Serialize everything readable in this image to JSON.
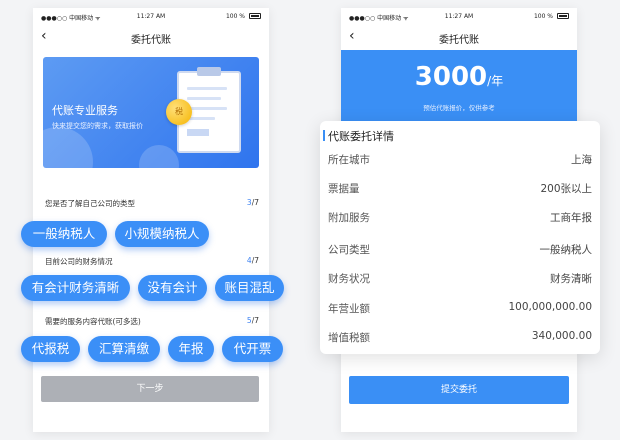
{
  "status": {
    "carrier": "●●●○○ 中国移动 ᯤ",
    "time": "11:27 AM",
    "battery": "100 %"
  },
  "left": {
    "nav": {
      "title": "委托代账"
    },
    "banner": {
      "title": "代账专业服务",
      "subtitle": "快来提交您的需求，获取报价",
      "coin": "税"
    },
    "q1": {
      "text": "您是否了解自己公司的类型",
      "current": "3",
      "total": "/7"
    },
    "q2": {
      "text": "目前公司的财务情况",
      "current": "4",
      "total": "/7"
    },
    "q3": {
      "text": "需要的服务内容代账(可多选)",
      "current": "5",
      "total": "/7"
    },
    "options1": [
      "一般纳税人",
      "小规模纳税人"
    ],
    "options2": [
      "有会计财务清晰",
      "没有会计",
      "账目混乱"
    ],
    "options3": [
      "代报税",
      "汇算清缴",
      "年报",
      "代开票"
    ],
    "next_button": "下一步"
  },
  "right": {
    "nav": {
      "title": "委托代账"
    },
    "price": {
      "amount": "3000",
      "unit": "/年",
      "subtitle": "预估代账报价，仅供参考"
    },
    "card": {
      "title": "代账委托详情",
      "rows": [
        {
          "label": "所在城市",
          "value": "上海"
        },
        {
          "label": "票据量",
          "value": "200张以上"
        },
        {
          "label": "附加服务",
          "value": "工商年报"
        },
        {
          "label": "公司类型",
          "value": "一般纳税人"
        },
        {
          "label": "财务状况",
          "value": "财务清晰"
        },
        {
          "label": "年营业额",
          "value": "100,000,000.00"
        },
        {
          "label": "增值税额",
          "value": "340,000.00"
        }
      ]
    },
    "submit_button": "提交委托"
  }
}
